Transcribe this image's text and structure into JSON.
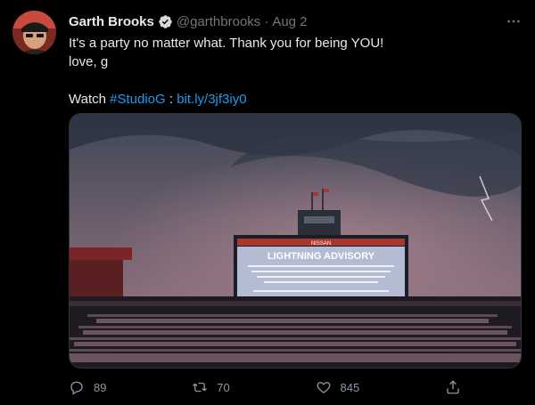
{
  "tweet": {
    "author_name": "Garth Brooks",
    "handle": "@garthbrooks",
    "separator": "·",
    "date": "Aug 2",
    "text_line1": "It's a party no matter what. Thank you for being YOU!",
    "text_line2": "love, g",
    "watch_prefix": "Watch ",
    "hashtag": "#StudioG",
    "colon": " : ",
    "short_link": "bit.ly/3jf3iy0",
    "image": {
      "scoreboard_brand": "NISSAN",
      "scoreboard_title": "LIGHTNING ADVISORY"
    },
    "stats": {
      "replies": "89",
      "retweets": "70",
      "likes": "845"
    }
  },
  "icons": {
    "verified": "verified-badge-icon",
    "more": "more-horizontal-icon",
    "reply": "reply-icon",
    "retweet": "retweet-icon",
    "like": "heart-icon",
    "share": "share-icon"
  },
  "colors": {
    "background": "#000000",
    "link": "#1d9bf0",
    "muted": "#71767b",
    "text": "#e7e9ea"
  }
}
